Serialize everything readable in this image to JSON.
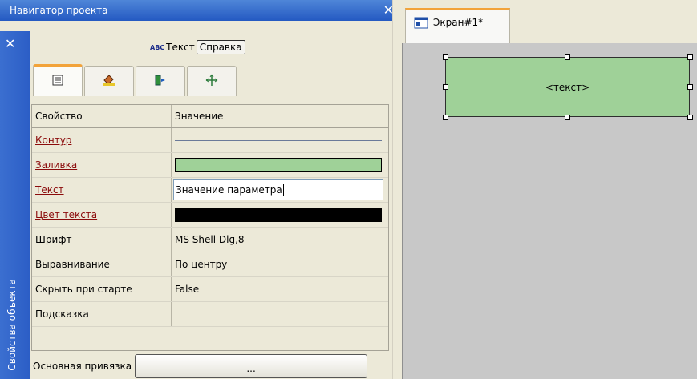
{
  "navigator": {
    "title": "Навигатор проекта",
    "close_glyph": "✕"
  },
  "side_panel": {
    "close_glyph": "✕",
    "label": "Свойства объекта"
  },
  "object": {
    "type_badge": "ABC",
    "type_label": "Текст",
    "help_label": "Справка"
  },
  "tabs": [
    {
      "icon": "properties-list-icon"
    },
    {
      "icon": "fill-bucket-icon"
    },
    {
      "icon": "events-icon"
    },
    {
      "icon": "move-arrows-icon"
    }
  ],
  "grid": {
    "col_property": "Свойство",
    "col_value": "Значение",
    "rows": [
      {
        "name": "Контур",
        "kind": "line",
        "link": true
      },
      {
        "name": "Заливка",
        "kind": "color",
        "color": "#9fd198",
        "link": true
      },
      {
        "name": "Текст",
        "kind": "edit",
        "value": "Значение параметра",
        "link": true
      },
      {
        "name": "Цвет текста",
        "kind": "color",
        "color": "#000000",
        "link": true
      },
      {
        "name": "Шрифт",
        "kind": "text",
        "value": "MS Shell Dlg,8"
      },
      {
        "name": "Выравнивание",
        "kind": "text",
        "value": "По центру"
      },
      {
        "name": "Скрыть при старте",
        "kind": "text",
        "value": "False"
      },
      {
        "name": "Подсказка",
        "kind": "text",
        "value": ""
      }
    ]
  },
  "binding": {
    "label": "Основная привязка",
    "button_label": "..."
  },
  "editor": {
    "tab_label": "Экран#1*",
    "shape_text": "<текст>",
    "shape_fill": "#9fd198"
  }
}
